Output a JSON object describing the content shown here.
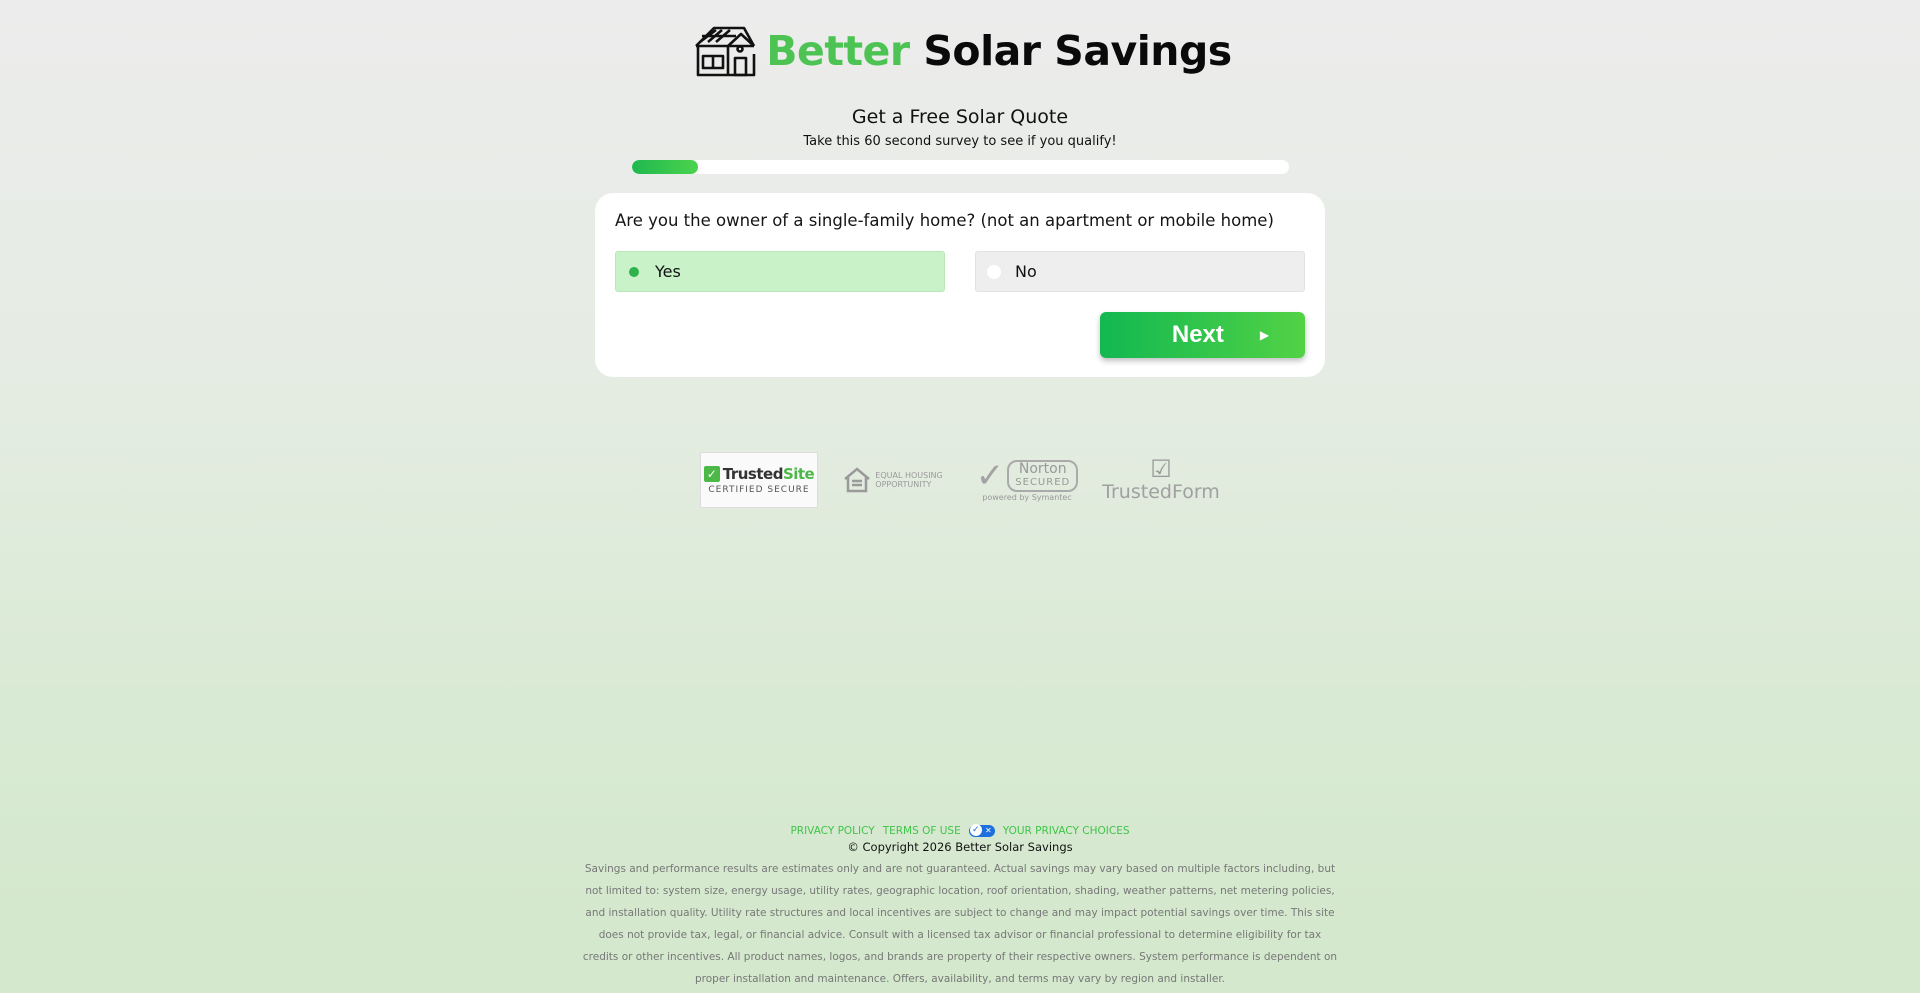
{
  "brand": {
    "name_accent": "Better",
    "name_rest": "Solar Savings",
    "accent_color": "#4cc352",
    "logo_icon": "solar-house-icon"
  },
  "hero": {
    "title": "Get a Free Solar Quote",
    "subtitle": "Take this 60 second survey to see if you qualify!",
    "progress_fraction": 0.1
  },
  "question": {
    "text": "Are you the owner of a single-family home? (not an apartment or mobile home)",
    "options": [
      {
        "label": "Yes",
        "selected": true
      },
      {
        "label": "No",
        "selected": false
      }
    ],
    "next_label": "Next",
    "next_icon": "play-arrow-icon"
  },
  "badges": {
    "trusted_site_name_a": "Trusted",
    "trusted_site_name_b": "Site",
    "trusted_site_sub": "CERTIFIED SECURE",
    "eho_line1": "EQUAL HOUSING",
    "eho_line2": "OPPORTUNITY",
    "norton_name": "Norton",
    "norton_secured": "SECURED",
    "norton_sub": "powered by Symantec",
    "trustedform": "TrustedForm"
  },
  "footer": {
    "privacy_policy": "PRIVACY POLICY",
    "terms_of_use": "TERMS OF USE",
    "privacy_choices": "YOUR PRIVACY CHOICES",
    "copyright": "© Copyright 2026 Better Solar Savings",
    "disclaimer": "Savings and performance results are estimates only and are not guaranteed. Actual savings may vary based on multiple factors including, but not limited to: system size, energy usage, utility rates, geographic location, roof orientation, shading, weather patterns, net metering policies, and installation quality. Utility rate structures and local incentives are subject to change and may impact potential savings over time. This site does not provide tax, legal, or financial advice. Consult with a licensed tax advisor or financial professional to determine eligibility for tax credits or other incentives. All product names, logos, and brands are property of their respective owners. System performance is dependent on proper installation and maintenance. Offers, availability, and terms may vary by region and installer."
  }
}
